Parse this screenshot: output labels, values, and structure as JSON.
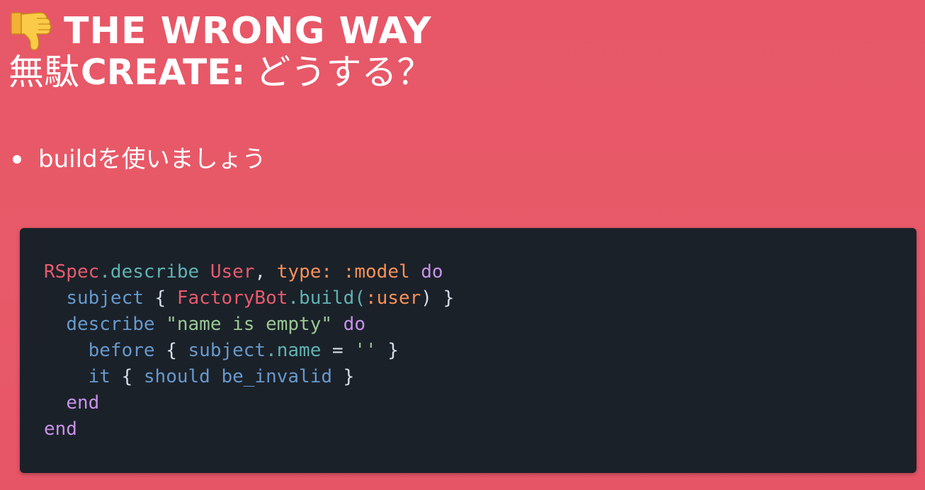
{
  "title": {
    "line1": "The Wrong Way",
    "line2_kanji": "無駄",
    "line2_create": "create:",
    "line2_jp": "どうする？"
  },
  "bullets": [
    "buildを使いましょう"
  ],
  "icons": {
    "title_icon": "thumbs-down-icon",
    "bullet": "bullet-dot"
  },
  "colors": {
    "background": "#e85868",
    "code_background": "#1b2129"
  },
  "code": {
    "language": "ruby",
    "lines": [
      [
        {
          "t": "RSpec",
          "c": "const"
        },
        {
          "t": ".describe ",
          "c": "method"
        },
        {
          "t": "User",
          "c": "const"
        },
        {
          "t": ", ",
          "c": "plain"
        },
        {
          "t": "type:",
          "c": "sym"
        },
        {
          "t": " ",
          "c": "plain"
        },
        {
          "t": ":model",
          "c": "sym"
        },
        {
          "t": " ",
          "c": "plain"
        },
        {
          "t": "do",
          "c": "kw"
        }
      ],
      [
        {
          "t": "  ",
          "c": "plain"
        },
        {
          "t": "subject",
          "c": "ident"
        },
        {
          "t": " { ",
          "c": "plain"
        },
        {
          "t": "FactoryBot",
          "c": "const"
        },
        {
          "t": ".build(",
          "c": "method"
        },
        {
          "t": ":user",
          "c": "sym"
        },
        {
          "t": ") }",
          "c": "plain"
        }
      ],
      [
        {
          "t": "  ",
          "c": "plain"
        },
        {
          "t": "describe",
          "c": "ident"
        },
        {
          "t": " ",
          "c": "plain"
        },
        {
          "t": "\"name is empty\"",
          "c": "str"
        },
        {
          "t": " ",
          "c": "plain"
        },
        {
          "t": "do",
          "c": "kw"
        }
      ],
      [
        {
          "t": "    ",
          "c": "plain"
        },
        {
          "t": "before",
          "c": "ident"
        },
        {
          "t": " { ",
          "c": "plain"
        },
        {
          "t": "subject",
          "c": "ident"
        },
        {
          "t": ".name",
          "c": "method"
        },
        {
          "t": " = ",
          "c": "plain"
        },
        {
          "t": "''",
          "c": "str"
        },
        {
          "t": " }",
          "c": "plain"
        }
      ],
      [
        {
          "t": "    ",
          "c": "plain"
        },
        {
          "t": "it",
          "c": "ident"
        },
        {
          "t": " { ",
          "c": "plain"
        },
        {
          "t": "should be_invalid",
          "c": "ident"
        },
        {
          "t": " }",
          "c": "plain"
        }
      ],
      [
        {
          "t": "  ",
          "c": "plain"
        },
        {
          "t": "end",
          "c": "kw"
        }
      ],
      [
        {
          "t": "end",
          "c": "kw"
        }
      ]
    ]
  }
}
